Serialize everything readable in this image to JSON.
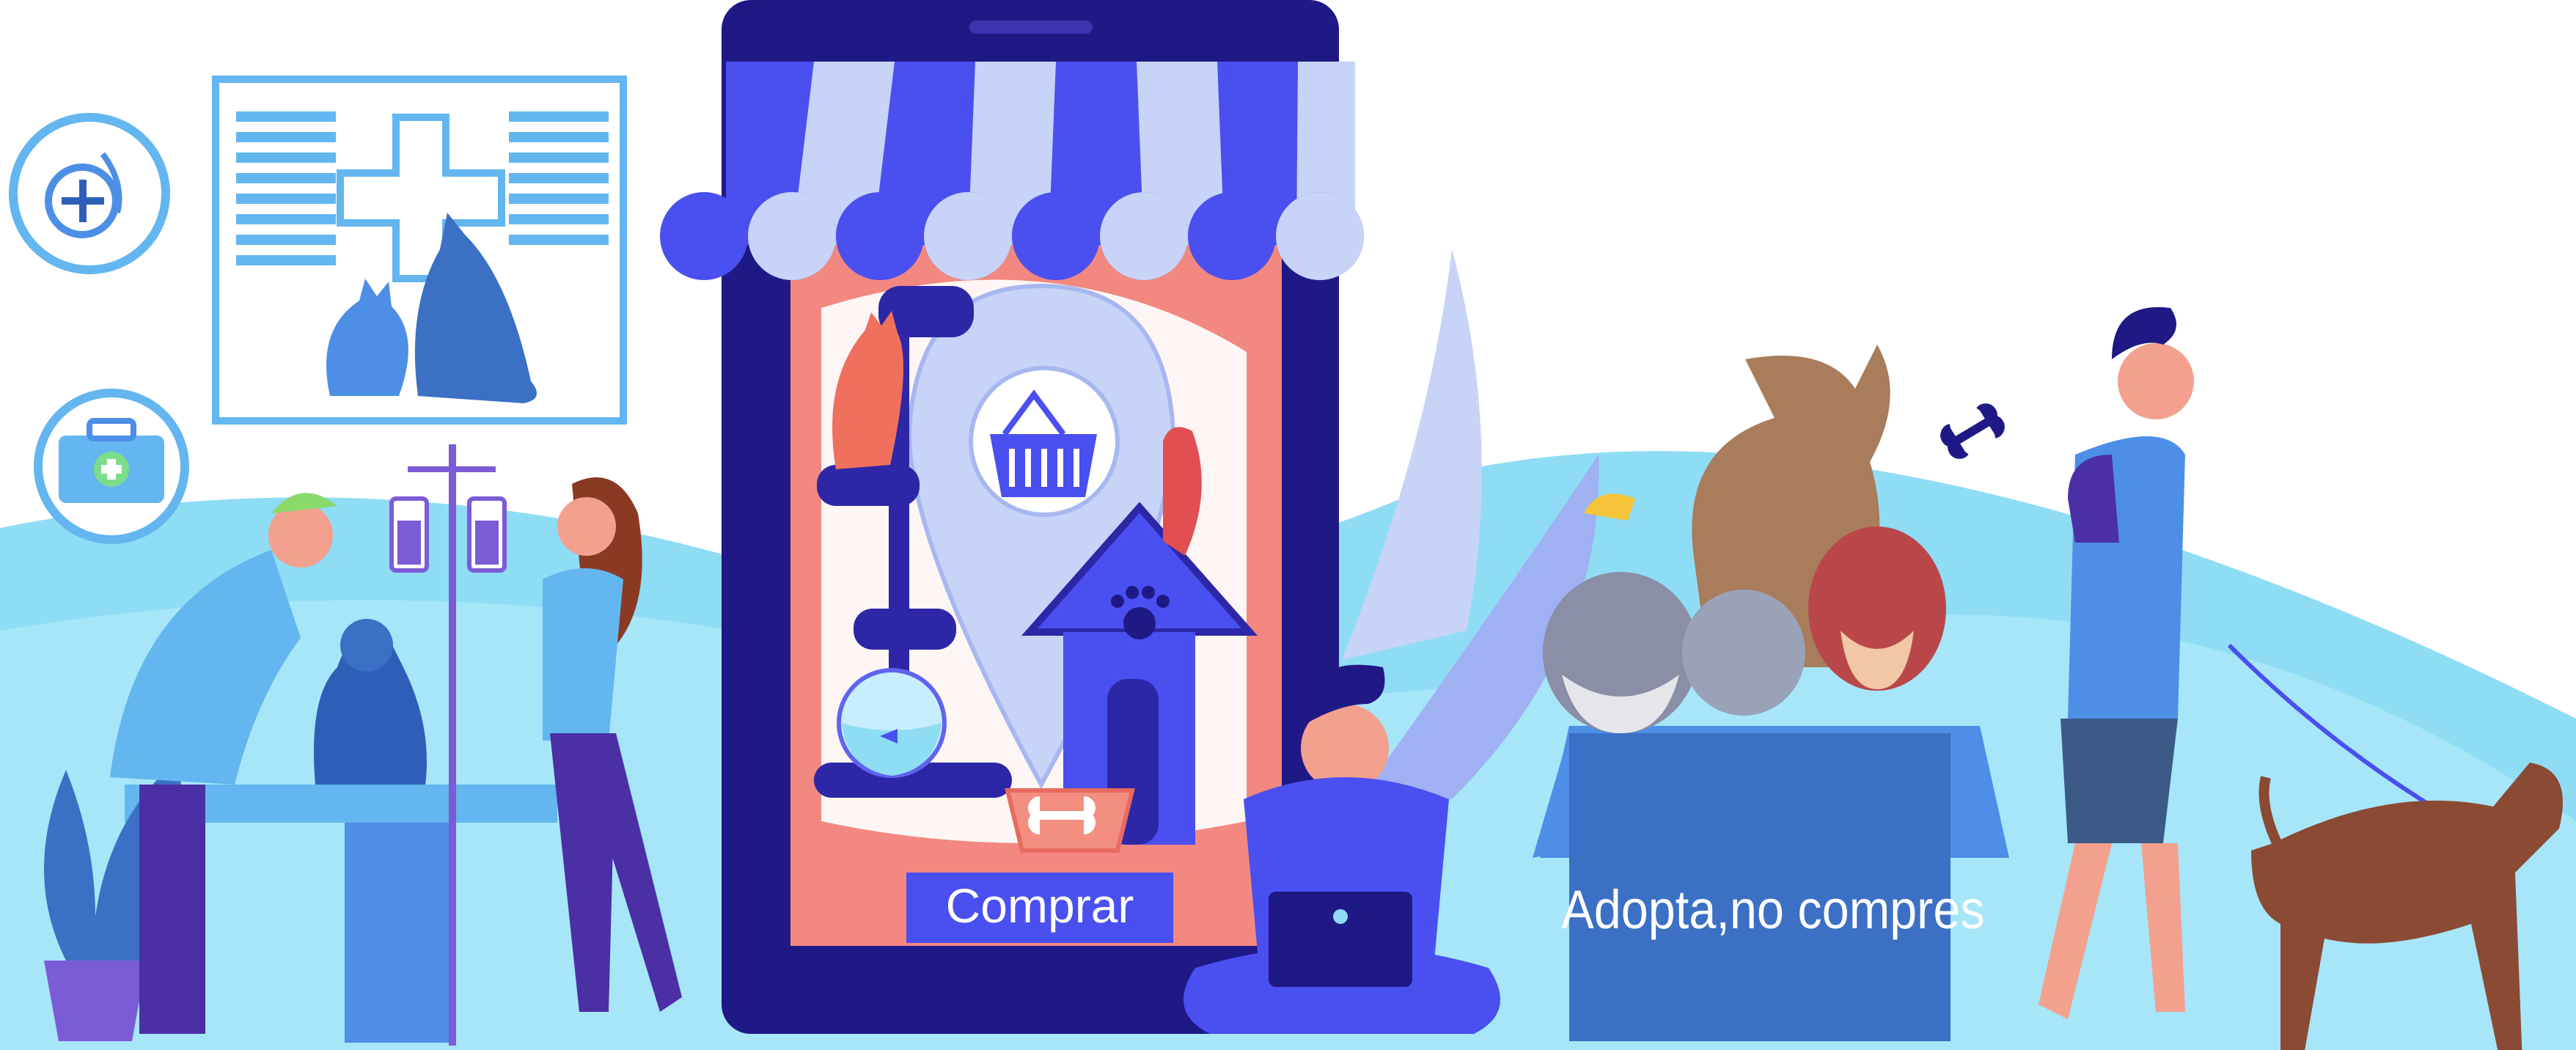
{
  "illustration": {
    "shop_button_label": "Comprar",
    "adoption_box_label": "Adopta,no compres"
  },
  "colors": {
    "background_wave": "#8fdcf5",
    "phone_body": "#1f1985",
    "awning_dark": "#4a4ff0",
    "awning_light": "#c7d3f7",
    "phone_screen": "#f28880",
    "button_fill": "#4a4ff0",
    "box_fill": "#3b70c4",
    "clinic_frame": "#63b6ef"
  },
  "icons": [
    "stethoscope-icon",
    "first-aid-kit-icon",
    "medical-cross-icon",
    "shopping-basket-icon",
    "paw-icon",
    "bone-icon"
  ]
}
